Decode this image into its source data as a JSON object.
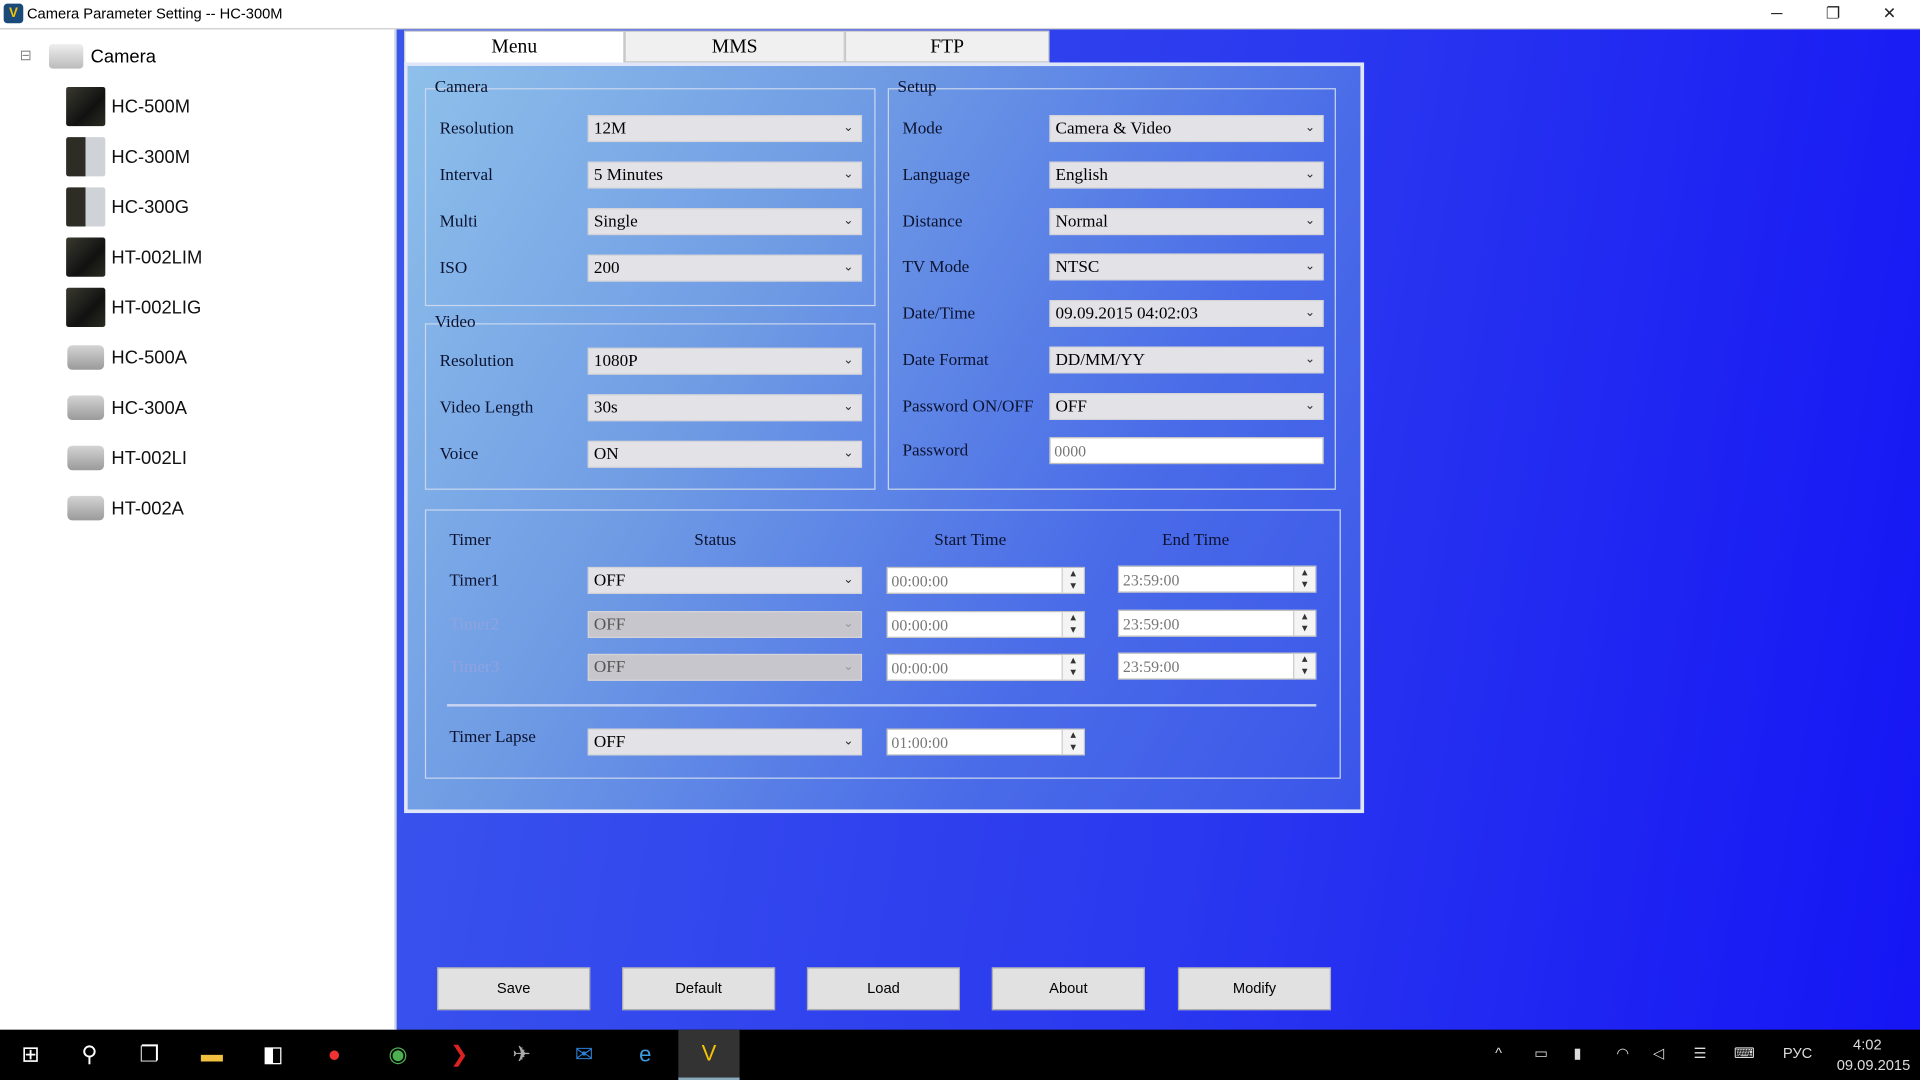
{
  "window": {
    "title": "Camera Parameter Setting -- HC-300M",
    "minimize": "─",
    "restore": "❐",
    "close": "✕"
  },
  "tree": {
    "root": "Camera",
    "collapse": "⊟",
    "items": [
      {
        "label": "HC-500M",
        "icon": "dark"
      },
      {
        "label": "HC-300M",
        "icon": "mix"
      },
      {
        "label": "HC-300G",
        "icon": "mix"
      },
      {
        "label": "HT-002LIM",
        "icon": "dark"
      },
      {
        "label": "HT-002LIG",
        "icon": "dark"
      },
      {
        "label": "HC-500A",
        "icon": "gray"
      },
      {
        "label": "HC-300A",
        "icon": "gray"
      },
      {
        "label": "HT-002LI",
        "icon": "gray"
      },
      {
        "label": "HT-002A",
        "icon": "gray"
      }
    ]
  },
  "tabs": [
    {
      "label": "Menu",
      "active": true
    },
    {
      "label": "MMS"
    },
    {
      "label": "FTP"
    }
  ],
  "camera": {
    "title": "Camera",
    "fields": [
      {
        "label": "Resolution",
        "value": "12M"
      },
      {
        "label": "Interval",
        "value": "5 Minutes"
      },
      {
        "label": "Multi",
        "value": "Single"
      },
      {
        "label": "ISO",
        "value": "200"
      }
    ]
  },
  "video": {
    "title": "Video",
    "fields": [
      {
        "label": "Resolution",
        "value": "1080P"
      },
      {
        "label": "Video Length",
        "value": "30s"
      },
      {
        "label": "Voice",
        "value": "ON"
      }
    ]
  },
  "setup": {
    "title": "Setup",
    "fields": [
      {
        "label": "Mode",
        "value": "Camera & Video"
      },
      {
        "label": "Language",
        "value": "English"
      },
      {
        "label": "Distance",
        "value": "Normal"
      },
      {
        "label": "TV Mode",
        "value": "NTSC"
      },
      {
        "label": "Date/Time",
        "value": "09.09.2015 04:02:03"
      },
      {
        "label": "Date Format",
        "value": "DD/MM/YY"
      },
      {
        "label": "Password ON/OFF",
        "value": "OFF"
      }
    ],
    "password_label": "Password",
    "password_value": "0000"
  },
  "timer": {
    "headers": {
      "timer": "Timer",
      "status": "Status",
      "start": "Start Time",
      "end": "End Time"
    },
    "rows": [
      {
        "label": "Timer1",
        "status": "OFF",
        "start": "00:00:00",
        "end": "23:59:00",
        "enabled": true
      },
      {
        "label": "Timer2",
        "status": "OFF",
        "start": "00:00:00",
        "end": "23:59:00",
        "enabled": false
      },
      {
        "label": "Timer3",
        "status": "OFF",
        "start": "00:00:00",
        "end": "23:59:00",
        "enabled": false
      }
    ],
    "lapse": {
      "label": "Timer Lapse",
      "status": "OFF",
      "value": "01:00:00"
    }
  },
  "buttons": {
    "save": "Save",
    "default": "Default",
    "load": "Load",
    "about": "About",
    "modify": "Modify"
  },
  "taskbar": {
    "language": "РУС",
    "time": "4:02",
    "date": "09.09.2015"
  },
  "colors": {
    "panel_top": "#8ec0ea",
    "background_blue": "#1515f5"
  }
}
